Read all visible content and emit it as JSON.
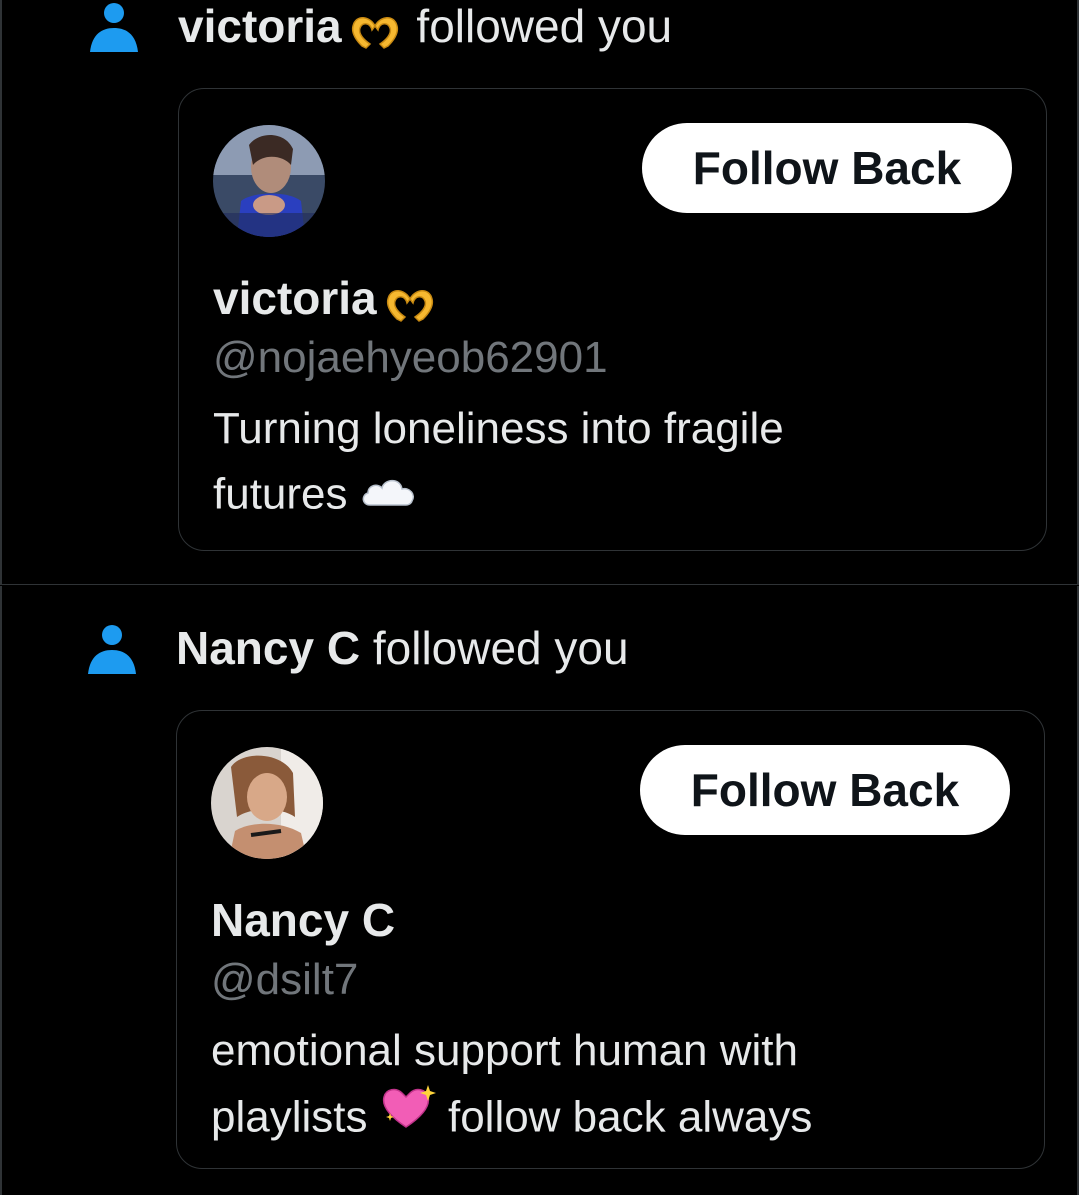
{
  "notifications": [
    {
      "name": "victoria",
      "action": "followed you",
      "card": {
        "display_name": "victoria",
        "handle": "@nojaehyeob62901",
        "bio_line1": "Turning loneliness into fragile",
        "bio_line2": "futures",
        "follow_label": "Follow Back"
      }
    },
    {
      "name": "Nancy C",
      "action": "followed you",
      "card": {
        "display_name": "Nancy C",
        "handle": "@dsilt7",
        "bio_line1": "emotional support human with",
        "bio_line2_a": "playlists",
        "bio_line2_b": "follow back always",
        "follow_label": "Follow Back"
      }
    }
  ],
  "colors": {
    "background": "#000000",
    "accent": "#1d9bf0",
    "text_primary": "#e7e9ea",
    "text_secondary": "#71767b",
    "border": "#2f3336",
    "button_bg": "#ffffff",
    "button_text": "#0f1419"
  },
  "icons": [
    "person-icon",
    "heart-hands-emoji",
    "cloud-emoji",
    "sparkling-heart-emoji"
  ]
}
